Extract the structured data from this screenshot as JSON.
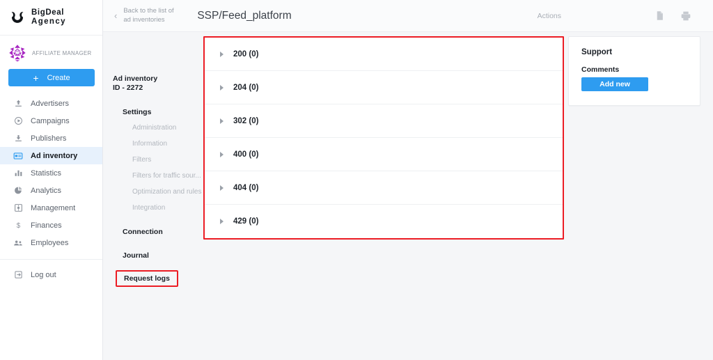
{
  "brand": {
    "line1": "BigDeal",
    "line2": "Agency",
    "logo_icon": "bigdeal-shield-logo"
  },
  "account": {
    "avatar_icon": "user-identicon-avatar",
    "role": "AFFILIATE MANAGER",
    "create_label": "Create",
    "create_icon": "plus-icon",
    "accent_color": "#2e9cf0"
  },
  "sidebar": {
    "items": [
      {
        "label": "Advertisers",
        "icon": "upload-arrow-icon",
        "active": false
      },
      {
        "label": "Campaigns",
        "icon": "play-circle-icon",
        "active": false
      },
      {
        "label": "Publishers",
        "icon": "download-arrow-icon",
        "active": false
      },
      {
        "label": "Ad inventory",
        "icon": "ad-card-icon",
        "active": true
      },
      {
        "label": "Statistics",
        "icon": "bar-chart-icon",
        "active": false
      },
      {
        "label": "Analytics",
        "icon": "pie-chart-icon",
        "active": false
      },
      {
        "label": "Management",
        "icon": "settings-box-icon",
        "active": false
      },
      {
        "label": "Finances",
        "icon": "dollar-sign-icon",
        "active": false
      },
      {
        "label": "Employees",
        "icon": "people-icon",
        "active": false
      }
    ],
    "logout": {
      "label": "Log out",
      "icon": "logout-icon"
    },
    "active_bg": "#e7f1fc"
  },
  "subnav": {
    "entity_title": "Ad inventory",
    "entity_id": "ID - 2272",
    "settings_header": "Settings",
    "settings_links": [
      "Administration",
      "Information",
      "Filters",
      "Filters for traffic sour...",
      "Optimization and rules",
      "Integration"
    ],
    "connection_header": "Connection",
    "journal_header": "Journal",
    "request_logs_header": "Request logs",
    "highlight_color": "#ec1c24"
  },
  "header": {
    "back_label": "Back to the list of ad inventories",
    "back_icon": "chevron-left-icon",
    "page_title": "SSP/Feed_platform",
    "actions_label": "Actions",
    "icons": [
      {
        "name": "document-icon"
      },
      {
        "name": "print-icon"
      }
    ]
  },
  "main": {
    "highlight_color": "#ec1c24",
    "accordion_rows": [
      {
        "label": "200 (0)",
        "caret_icon": "caret-right-icon"
      },
      {
        "label": "204 (0)",
        "caret_icon": "caret-right-icon"
      },
      {
        "label": "302 (0)",
        "caret_icon": "caret-right-icon"
      },
      {
        "label": "400 (0)",
        "caret_icon": "caret-right-icon"
      },
      {
        "label": "404 (0)",
        "caret_icon": "caret-right-icon"
      },
      {
        "label": "429 (0)",
        "caret_icon": "caret-right-icon"
      }
    ]
  },
  "support": {
    "title": "Support",
    "comments_label": "Comments",
    "add_new_label": "Add new"
  }
}
